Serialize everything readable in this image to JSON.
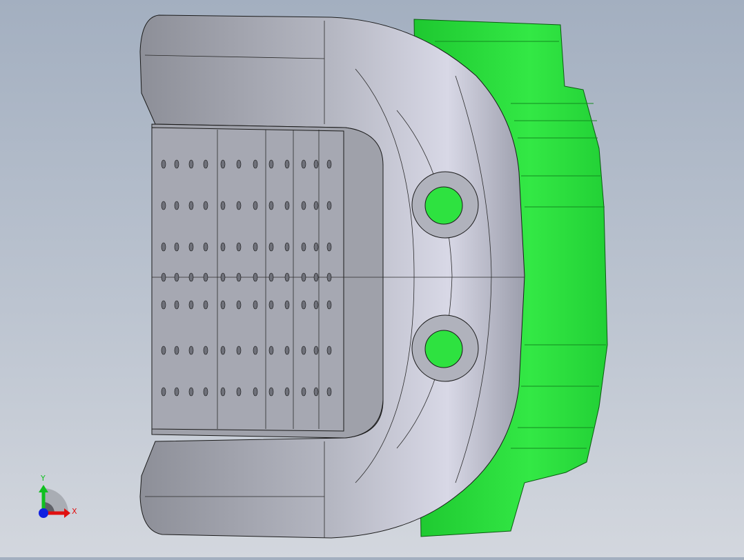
{
  "viewport": {
    "model": "cad-part",
    "colors": {
      "body": "#23e23a",
      "shell": "#b6b8c4",
      "edge": "#1a1a1a",
      "inner": "#9fa1aa"
    }
  },
  "triad": {
    "x_label": "X",
    "y_label": "Y",
    "colors": {
      "x": "#e01010",
      "y": "#10c020",
      "z": "#1020e0"
    }
  }
}
